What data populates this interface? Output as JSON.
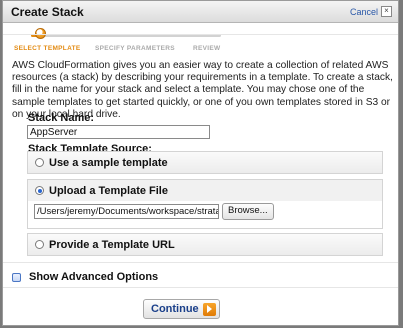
{
  "dialog": {
    "title": "Create Stack",
    "cancel_label": "Cancel",
    "close_glyph": "×"
  },
  "wizard": {
    "steps": [
      {
        "label": "SELECT TEMPLATE",
        "state": "active"
      },
      {
        "label": "SPECIFY PARAMETERS",
        "state": "inactive"
      },
      {
        "label": "REVIEW",
        "state": "inactive"
      }
    ]
  },
  "intro": "AWS CloudFormation gives you an easier way to create a collection of related AWS resources (a stack) by describing your requirements in a template. To create a stack, fill in the name for your stack and select a template. You may chose one of the sample templates to get started quickly, or one of you own templates stored in S3 or on your local hard drive.",
  "stack_name": {
    "label": "Stack Name:",
    "value": "AppServer"
  },
  "template_source": {
    "label": "Stack Template Source:",
    "options": [
      {
        "label": "Use a sample template",
        "checked": false
      },
      {
        "label": "Upload a Template File",
        "checked": true
      },
      {
        "label": "Provide a Template URL",
        "checked": false
      }
    ],
    "file_path": "/Users/jeremy/Documents/workspace/stratalux/c",
    "browse_label": "Browse..."
  },
  "advanced": {
    "label": "Show Advanced Options",
    "checked": false
  },
  "continue_label": "Continue",
  "colors": {
    "accent_orange": "#e38b13",
    "link_blue": "#2a58a8"
  }
}
